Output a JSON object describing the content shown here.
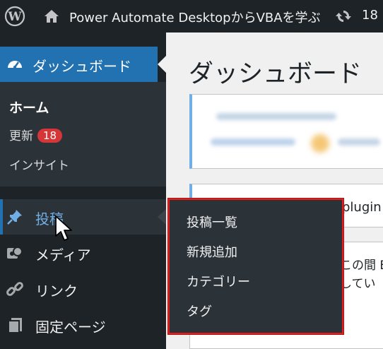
{
  "admin_bar": {
    "wp_logo_icon": "wordpress-logo-icon",
    "home_icon": "house-icon",
    "site_name": "Power Automate DesktopからVBAを学ぶ",
    "updates_icon": "refresh-icon",
    "updates_count": "18"
  },
  "sidebar": {
    "dashboard": {
      "icon": "gauge-icon",
      "label": "ダッシュボード"
    },
    "submenu": {
      "home": "ホーム",
      "updates": "更新",
      "updates_badge": "18",
      "insight": "インサイト"
    },
    "items": [
      {
        "icon": "pushpin-icon",
        "label": "投稿"
      },
      {
        "icon": "media-icon",
        "label": "メディア"
      },
      {
        "icon": "link-icon",
        "label": "リンク"
      },
      {
        "icon": "page-icon",
        "label": "固定ページ"
      }
    ]
  },
  "main": {
    "page_title": "ダッシュボード",
    "card2_text": "plugin",
    "card3_line1": "この間 E",
    "card3_line2": "してい"
  },
  "flyout": {
    "items": [
      "投稿一覧",
      "新規追加",
      "カテゴリー",
      "タグ"
    ]
  },
  "colors": {
    "admin_bar_bg": "#1d2327",
    "menu_active": "#2271b1",
    "submenu_bg": "#2c3338",
    "badge": "#d63638",
    "highlight_border": "#e01e1e",
    "content_bg": "#f0f0f1"
  }
}
